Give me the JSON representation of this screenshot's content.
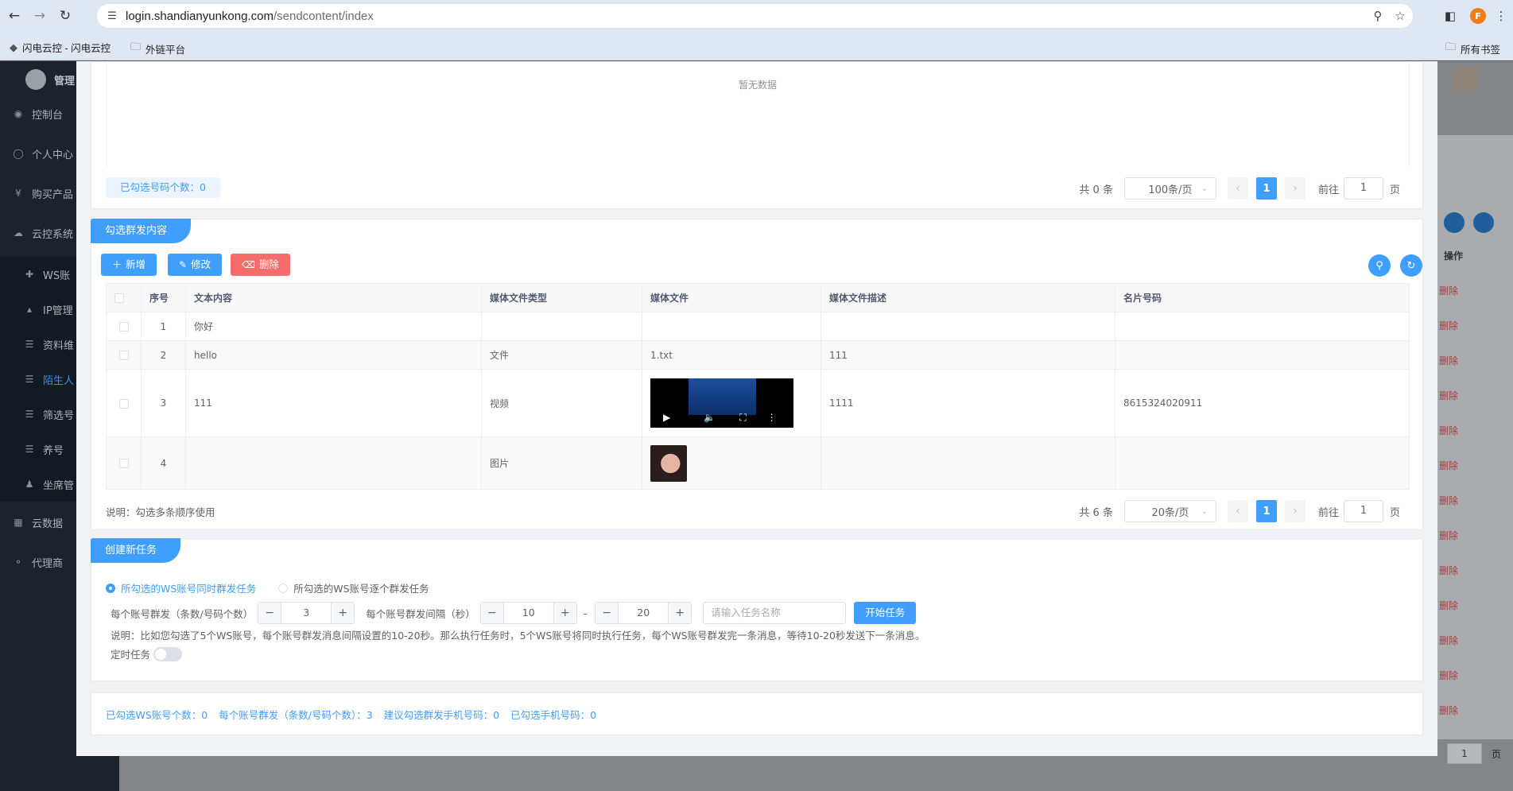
{
  "browser": {
    "url_host": "login.shandianyunkong.com",
    "url_path": "/sendcontent/index",
    "profile_initial": "F",
    "bookmarks": [
      {
        "label": "闪电云控 - 闪电云控"
      },
      {
        "label": "外链平台"
      }
    ],
    "bookmarks_right": "所有书签"
  },
  "sidebar": {
    "brand": "管理",
    "items": [
      {
        "label": "控制台",
        "icon": "dashboard-icon"
      },
      {
        "label": "个人中心",
        "icon": "user-icon"
      },
      {
        "label": "购买产品",
        "icon": "yen-icon"
      },
      {
        "label": "云控系统",
        "icon": "cloud-icon"
      },
      {
        "label": "WS账",
        "icon": "plus-icon"
      },
      {
        "label": "IP管理",
        "icon": "ip-icon"
      },
      {
        "label": "资料维",
        "icon": "list-icon"
      },
      {
        "label": "陌生人",
        "icon": "list-icon"
      },
      {
        "label": "筛选号",
        "icon": "list-icon"
      },
      {
        "label": "养号",
        "icon": "list-icon"
      },
      {
        "label": "坐席管",
        "icon": "person-icon"
      },
      {
        "label": "云数据",
        "icon": "data-icon"
      },
      {
        "label": "代理商",
        "icon": "agent-icon"
      }
    ]
  },
  "background": {
    "operation_header": "操作",
    "delete_label": "删除",
    "page_value": "1",
    "page_suffix": "页"
  },
  "top_section": {
    "empty_text": "暂无数据",
    "selected_count_label": "已勾选号码个数：0",
    "pagination": {
      "total": "共 0 条",
      "page_size": "100条/页",
      "current": "1",
      "goto_label": "前往",
      "goto_value": "1",
      "page_suffix": "页"
    }
  },
  "content_section": {
    "title": "勾选群发内容",
    "buttons": {
      "add": "新增",
      "edit": "修改",
      "delete": "删除"
    },
    "columns": [
      "序号",
      "文本内容",
      "媒体文件类型",
      "媒体文件",
      "媒体文件描述",
      "名片号码"
    ],
    "rows": [
      {
        "index": "1",
        "text": "你好",
        "media_type": "",
        "media_file": "",
        "media_desc": "",
        "card_number": ""
      },
      {
        "index": "2",
        "text": "hello",
        "media_type": "文件",
        "media_file": "1.txt",
        "media_desc": "111",
        "card_number": ""
      },
      {
        "index": "3",
        "text": "111",
        "media_type": "视频",
        "media_file": "",
        "media_desc": "1111",
        "card_number": "8615324020911"
      },
      {
        "index": "4",
        "text": "",
        "media_type": "图片",
        "media_file": "",
        "media_desc": "",
        "card_number": ""
      }
    ],
    "note": "说明：勾选多条顺序使用",
    "pagination": {
      "total": "共 6 条",
      "page_size": "20条/页",
      "current": "1",
      "goto_label": "前往",
      "goto_value": "1",
      "page_suffix": "页"
    }
  },
  "task_section": {
    "title": "创建新任务",
    "radio_simultaneous": "所勾选的WS账号同时群发任务",
    "radio_sequential": "所勾选的WS账号逐个群发任务",
    "per_account_label": "每个账号群发（条数/号码个数）",
    "per_account_value": "3",
    "interval_label": "每个账号群发间隔（秒）",
    "interval_min": "10",
    "interval_sep": "-",
    "interval_max": "20",
    "task_name_placeholder": "请输入任务名称",
    "start_button": "开始任务",
    "explanation": "说明：比如您勾选了5个WS账号，每个账号群发消息间隔设置的10-20秒。那么执行任务时，5个WS账号将同时执行任务，每个WS账号群发完一条消息，等待10-20秒发送下一条消息。",
    "scheduled_label": "定时任务"
  },
  "summary": {
    "ws_count": "已勾选WS账号个数：0",
    "per_account": "每个账号群发（条数/号码个数）：3",
    "suggest": "建议勾选群发手机号码：0",
    "phones": "已勾选手机号码：0"
  }
}
